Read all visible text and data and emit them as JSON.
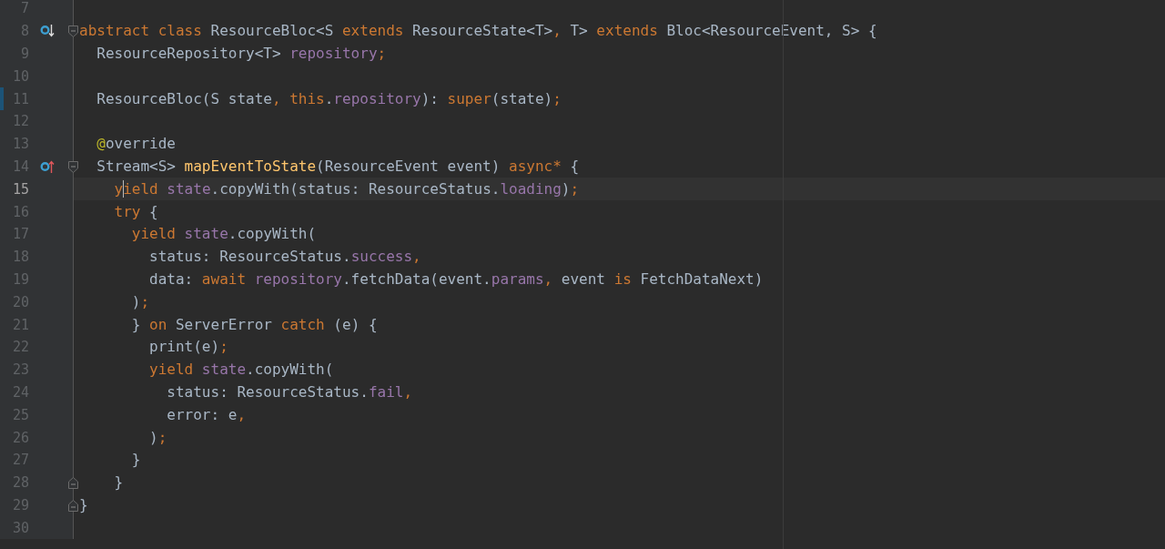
{
  "editor": {
    "lines": [
      {
        "number": "7",
        "current": false,
        "changed": false
      },
      {
        "number": "8",
        "current": false,
        "changed": false,
        "gutter_icon": {
          "kind": "implemented"
        },
        "fold_marker": {
          "kind": "start"
        },
        "tokens": [
          {
            "text": "abstract class",
            "kind": "keyword"
          },
          {
            "text": " ResourceBloc<S ",
            "kind": "plain"
          },
          {
            "text": "extends",
            "kind": "keyword"
          },
          {
            "text": " ResourceState<T>",
            "kind": "plain"
          },
          {
            "text": ",",
            "kind": "keyword"
          },
          {
            "text": " T> ",
            "kind": "plain"
          },
          {
            "text": "extends",
            "kind": "keyword"
          },
          {
            "text": " Bloc<ResourceEvent, S> {",
            "kind": "plain"
          }
        ]
      },
      {
        "number": "9",
        "current": false,
        "changed": false,
        "tokens": [
          {
            "text": "  ResourceRepository<T> ",
            "kind": "plain"
          },
          {
            "text": "repository",
            "kind": "field"
          },
          {
            "text": ";",
            "kind": "keyword"
          }
        ]
      },
      {
        "number": "10",
        "current": false,
        "changed": false
      },
      {
        "number": "11",
        "current": false,
        "changed": true,
        "tokens": [
          {
            "text": "  ResourceBloc(S state",
            "kind": "plain"
          },
          {
            "text": ", this",
            "kind": "keyword"
          },
          {
            "text": ".",
            "kind": "plain"
          },
          {
            "text": "repository",
            "kind": "field"
          },
          {
            "text": "): ",
            "kind": "plain"
          },
          {
            "text": "super",
            "kind": "keyword"
          },
          {
            "text": "(state)",
            "kind": "plain"
          },
          {
            "text": ";",
            "kind": "keyword"
          }
        ]
      },
      {
        "number": "12",
        "current": false,
        "changed": false
      },
      {
        "number": "13",
        "current": false,
        "changed": false,
        "tokens": [
          {
            "text": "  @",
            "kind": "annotation"
          },
          {
            "text": "override",
            "kind": "plain"
          }
        ]
      },
      {
        "number": "14",
        "current": false,
        "changed": false,
        "gutter_icon": {
          "kind": "overriding"
        },
        "fold_marker": {
          "kind": "start"
        },
        "tokens": [
          {
            "text": "  Stream<S> ",
            "kind": "plain"
          },
          {
            "text": "mapEventToState",
            "kind": "function"
          },
          {
            "text": "(ResourceEvent event) ",
            "kind": "plain"
          },
          {
            "text": "async*",
            "kind": "keyword"
          },
          {
            "text": " {",
            "kind": "plain"
          }
        ]
      },
      {
        "number": "15",
        "current": true,
        "changed": false,
        "tokens": [
          {
            "text": "    y",
            "kind": "keyword"
          },
          {
            "kind": "caret"
          },
          {
            "text": "ield ",
            "kind": "keyword"
          },
          {
            "text": "state",
            "kind": "field"
          },
          {
            "text": ".copyWith(status: ResourceStatus.",
            "kind": "plain"
          },
          {
            "text": "loading",
            "kind": "field"
          },
          {
            "text": ")",
            "kind": "plain"
          },
          {
            "text": ";",
            "kind": "keyword"
          }
        ]
      },
      {
        "number": "16",
        "current": false,
        "changed": false,
        "tokens": [
          {
            "text": "    try",
            "kind": "keyword"
          },
          {
            "text": " {",
            "kind": "plain"
          }
        ]
      },
      {
        "number": "17",
        "current": false,
        "changed": false,
        "tokens": [
          {
            "text": "      yield ",
            "kind": "keyword"
          },
          {
            "text": "state",
            "kind": "field"
          },
          {
            "text": ".copyWith(",
            "kind": "plain"
          }
        ]
      },
      {
        "number": "18",
        "current": false,
        "changed": false,
        "tokens": [
          {
            "text": "        status: ResourceStatus.",
            "kind": "plain"
          },
          {
            "text": "success",
            "kind": "field"
          },
          {
            "text": ",",
            "kind": "keyword"
          }
        ]
      },
      {
        "number": "19",
        "current": false,
        "changed": false,
        "tokens": [
          {
            "text": "        data: ",
            "kind": "plain"
          },
          {
            "text": "await ",
            "kind": "keyword"
          },
          {
            "text": "repository",
            "kind": "field"
          },
          {
            "text": ".fetchData(event.",
            "kind": "plain"
          },
          {
            "text": "params",
            "kind": "field"
          },
          {
            "text": ",",
            "kind": "keyword"
          },
          {
            "text": " event ",
            "kind": "plain"
          },
          {
            "text": "is",
            "kind": "keyword"
          },
          {
            "text": " FetchDataNext)",
            "kind": "plain"
          }
        ]
      },
      {
        "number": "20",
        "current": false,
        "changed": false,
        "tokens": [
          {
            "text": "      )",
            "kind": "plain"
          },
          {
            "text": ";",
            "kind": "keyword"
          }
        ]
      },
      {
        "number": "21",
        "current": false,
        "changed": false,
        "tokens": [
          {
            "text": "      } ",
            "kind": "plain"
          },
          {
            "text": "on",
            "kind": "keyword"
          },
          {
            "text": " ServerError ",
            "kind": "plain"
          },
          {
            "text": "catch",
            "kind": "keyword"
          },
          {
            "text": " (e) {",
            "kind": "plain"
          }
        ]
      },
      {
        "number": "22",
        "current": false,
        "changed": false,
        "tokens": [
          {
            "text": "        print(e)",
            "kind": "plain"
          },
          {
            "text": ";",
            "kind": "keyword"
          }
        ]
      },
      {
        "number": "23",
        "current": false,
        "changed": false,
        "tokens": [
          {
            "text": "        yield ",
            "kind": "keyword"
          },
          {
            "text": "state",
            "kind": "field"
          },
          {
            "text": ".copyWith(",
            "kind": "plain"
          }
        ]
      },
      {
        "number": "24",
        "current": false,
        "changed": false,
        "tokens": [
          {
            "text": "          status: ResourceStatus.",
            "kind": "plain"
          },
          {
            "text": "fail",
            "kind": "field"
          },
          {
            "text": ",",
            "kind": "keyword"
          }
        ]
      },
      {
        "number": "25",
        "current": false,
        "changed": false,
        "tokens": [
          {
            "text": "          error: e",
            "kind": "plain"
          },
          {
            "text": ",",
            "kind": "keyword"
          }
        ]
      },
      {
        "number": "26",
        "current": false,
        "changed": false,
        "tokens": [
          {
            "text": "        )",
            "kind": "plain"
          },
          {
            "text": ";",
            "kind": "keyword"
          }
        ]
      },
      {
        "number": "27",
        "current": false,
        "changed": false,
        "tokens": [
          {
            "text": "      }",
            "kind": "plain"
          }
        ]
      },
      {
        "number": "28",
        "current": false,
        "changed": false,
        "fold_marker": {
          "kind": "end"
        },
        "tokens": [
          {
            "text": "    }",
            "kind": "plain"
          }
        ]
      },
      {
        "number": "29",
        "current": false,
        "changed": false,
        "fold_marker": {
          "kind": "end"
        },
        "tokens": [
          {
            "text": "}",
            "kind": "plain"
          }
        ]
      },
      {
        "number": "30",
        "current": false,
        "changed": false
      }
    ]
  }
}
